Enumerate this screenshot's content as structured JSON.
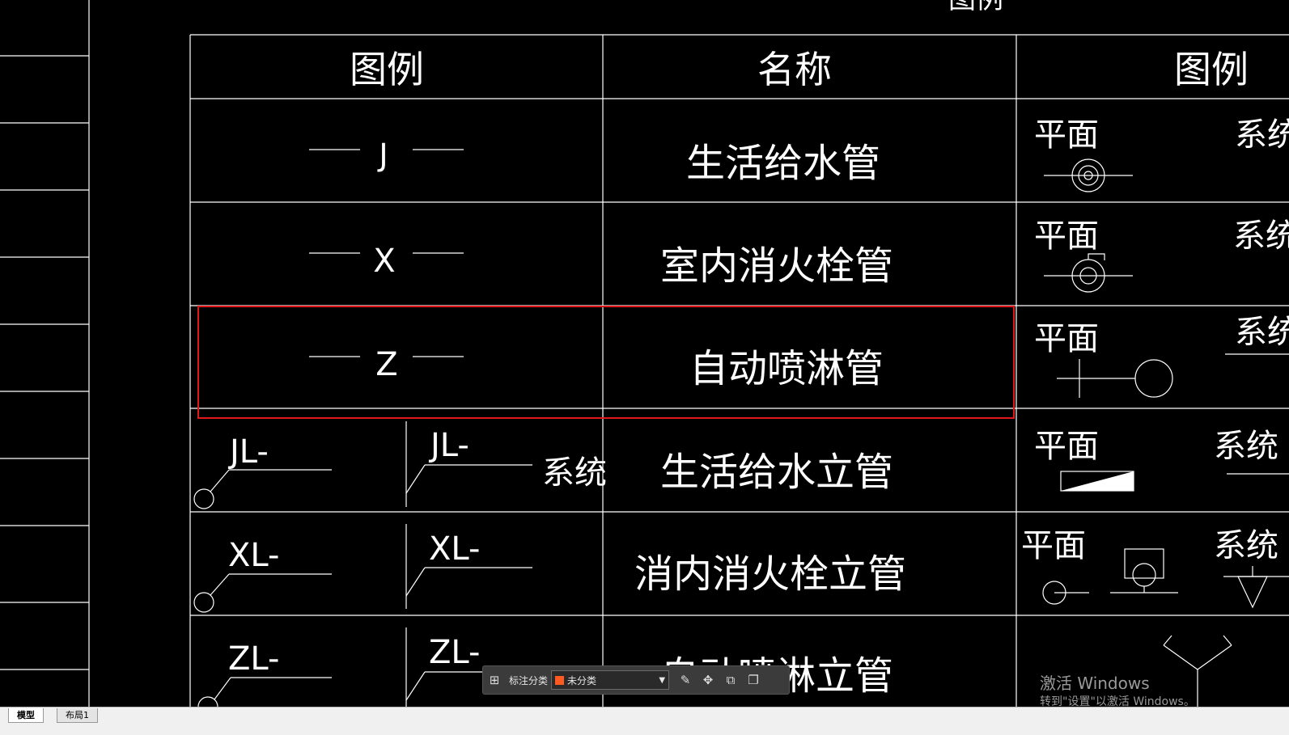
{
  "table": {
    "header_legend_left": "图例",
    "header_name": "名称",
    "header_legend_right": "图例",
    "top_cut_text": "图例",
    "rows": [
      {
        "symbol": "J",
        "name": "生活给水管",
        "plan": "平面",
        "system": "系统"
      },
      {
        "symbol": "X",
        "name": "室内消火栓管",
        "plan": "平面",
        "system": "系统"
      },
      {
        "symbol": "Z",
        "name": "自动喷淋管",
        "plan": "平面",
        "system": "系统"
      },
      {
        "riser": "JL-",
        "name": "生活给水立管",
        "plan": "平面",
        "system": "系统"
      },
      {
        "riser": "XL-",
        "name": "消内消火栓立管",
        "plan": "平面",
        "system": "系统"
      },
      {
        "riser": "ZL-",
        "name": "自动喷淋立管"
      }
    ]
  },
  "toolbar": {
    "label": "标注分类",
    "selected": "未分类",
    "swatch_color": "#ff5a1f"
  },
  "tabs": [
    {
      "label": "模型",
      "active": true
    },
    {
      "label": "布局1",
      "active": false
    }
  ],
  "watermark": {
    "title": "激活 Windows",
    "subtitle": "转到\"设置\"以激活 Windows。"
  },
  "highlight_color": "#e01818"
}
